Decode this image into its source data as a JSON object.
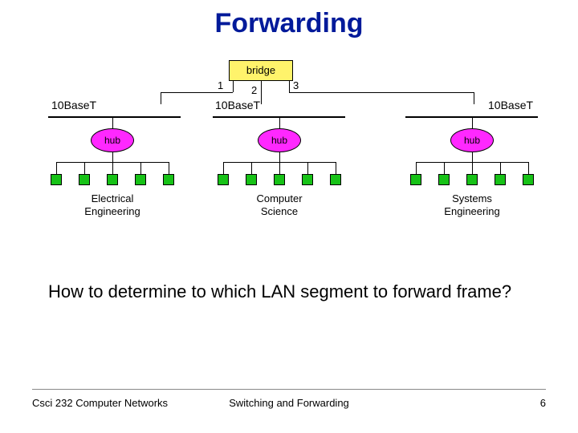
{
  "title": "Forwarding",
  "bridge": "bridge",
  "ports": {
    "p1": "1",
    "p2": "2",
    "p3": "3"
  },
  "segments": {
    "a": {
      "label": "10BaseT",
      "hub": "hub",
      "dept": "Electrical\nEngineering"
    },
    "b": {
      "label": "10BaseT",
      "hub": "hub",
      "dept": "Computer\nScience"
    },
    "c": {
      "label": "10BaseT",
      "hub": "hub",
      "dept": "Systems\nEngineering"
    }
  },
  "question": "How to determine to which LAN segment to forward frame?",
  "footer": {
    "left": "Csci 232 Computer Networks",
    "center": "Switching and Forwarding",
    "right": "6"
  }
}
